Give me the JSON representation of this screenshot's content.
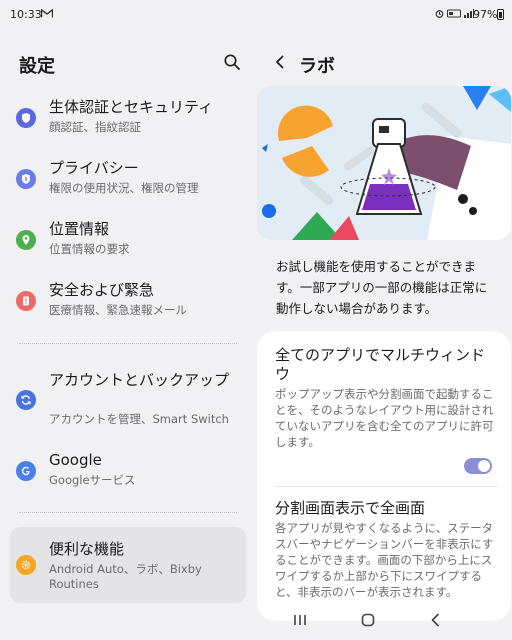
{
  "status_bar": {
    "time": "10:33",
    "battery": "97%",
    "icons": [
      "gmail-icon",
      "alarm-icon",
      "volte-icon",
      "signal-icon",
      "battery-icon"
    ]
  },
  "settings": {
    "title": "設定",
    "items": [
      {
        "title": "生体認証とセキュリティ",
        "subtitle": "顔認証、指紋認証",
        "icon": "shield-icon",
        "color": "#5b68e0"
      },
      {
        "title": "プライバシー",
        "subtitle": "権限の使用状況、権限の管理",
        "icon": "privacy-shield-icon",
        "color": "#6b7be9"
      },
      {
        "title": "位置情報",
        "subtitle": "位置情報の要求",
        "icon": "location-pin-icon",
        "color": "#4caf50"
      },
      {
        "title": "安全および緊急",
        "subtitle": "医療情報、緊急速報メール",
        "icon": "emergency-icon",
        "color": "#ef6a64"
      },
      {
        "title": "アカウントとバックアップ",
        "subtitle": "アカウントを管理、Smart Switch",
        "icon": "sync-icon",
        "color": "#4a72e0"
      },
      {
        "title": "Google",
        "subtitle": "Googleサービス",
        "icon": "google-icon",
        "color": "#4a80ea"
      },
      {
        "title": "便利な機能",
        "subtitle": "Android Auto、ラボ、Bixby Routines",
        "icon": "gear-plus-icon",
        "color": "#f5a623"
      }
    ]
  },
  "labs": {
    "title": "ラボ",
    "intro": "お試し機能を使用することができます。一部アプリの一部の機能は正常に動作しない場合があります。",
    "features": [
      {
        "title": "全てのアプリでマルチウィンドウ",
        "description": "ポップアップ表示や分割画面で起動することを、そのようなレイアウト用に設計されていないアプリを含む全てのアプリに許可します。",
        "enabled": true
      },
      {
        "title": "分割画面表示で全画面",
        "description": "各アプリが見やすくなるように、ステータスバーやナビゲーションバーを非表示にすることができます。画面の下部から上にスワイプするか上部から下にスワイプすると、非表示のバーが表示されます。"
      }
    ],
    "colors": {
      "toggle_on": "#8a8fd8"
    }
  },
  "nav_bar": {
    "buttons": [
      "recents-icon",
      "home-icon",
      "back-icon"
    ]
  }
}
